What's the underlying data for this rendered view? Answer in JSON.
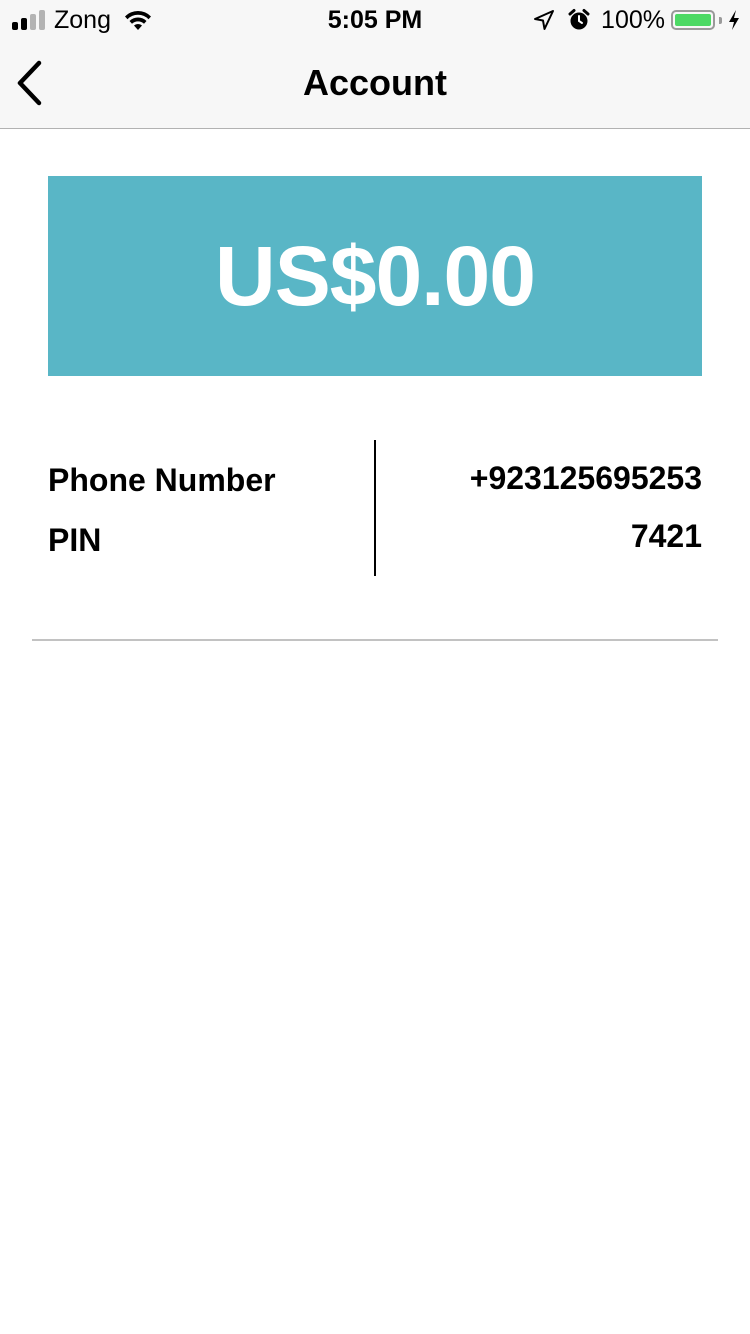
{
  "status_bar": {
    "carrier": "Zong",
    "time": "5:05 PM",
    "battery_percent": "100%",
    "battery_level": 1.0,
    "signal_bars_active": 2,
    "signal_bars_total": 4,
    "icons": [
      "signal-icon",
      "wifi-icon",
      "location-arrow-icon",
      "alarm-icon",
      "battery-icon",
      "charging-bolt-icon"
    ]
  },
  "nav": {
    "title": "Account",
    "back_icon": "chevron-left-icon"
  },
  "balance": {
    "amount": "US$0.00",
    "card_color": "#59b6c6"
  },
  "account_info": {
    "phone_label": "Phone Number",
    "phone_value": "+923125695253",
    "pin_label": "PIN",
    "pin_value": "7421"
  }
}
